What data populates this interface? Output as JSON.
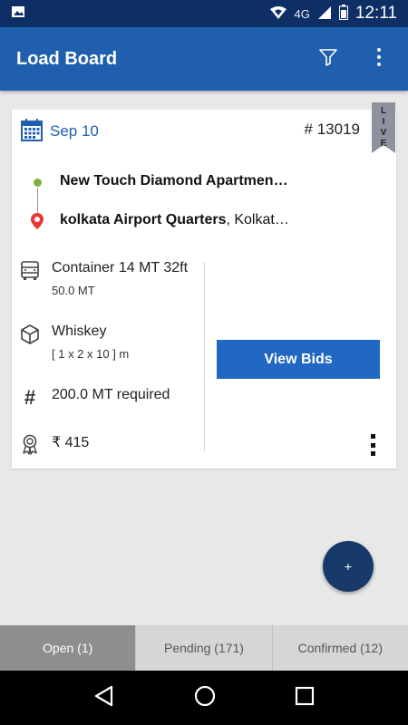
{
  "status_bar": {
    "time": "12:11",
    "network": "4G"
  },
  "app_bar": {
    "title": "Load Board"
  },
  "load_card": {
    "date": "Sep 10",
    "load_id": "# 13019",
    "status_ribbon": "LIVE",
    "origin": "New Touch Diamond Apartmen…",
    "destination_name": "kolkata Airport Quarters",
    "destination_rest": ", Kolkat…",
    "truck_type": "Container 14 MT 32ft",
    "capacity": "50.0 MT",
    "material": "Whiskey",
    "dimensions": "[ 1 x 2 x 10 ] m",
    "quantity": "200.0 MT required",
    "price": "₹ 415",
    "view_bids_label": "View Bids"
  },
  "fab": {
    "label": "+"
  },
  "tabs": [
    {
      "label": "Open (1)",
      "active": true
    },
    {
      "label": "Pending (171)",
      "active": false
    },
    {
      "label": "Confirmed (12)",
      "active": false
    }
  ],
  "colors": {
    "primary": "#1f5fad",
    "status_bar": "#0d2f66",
    "button": "#2168c2",
    "fab": "#173a6a",
    "origin_dot": "#7ab33b",
    "dest_pin": "#e53935"
  }
}
